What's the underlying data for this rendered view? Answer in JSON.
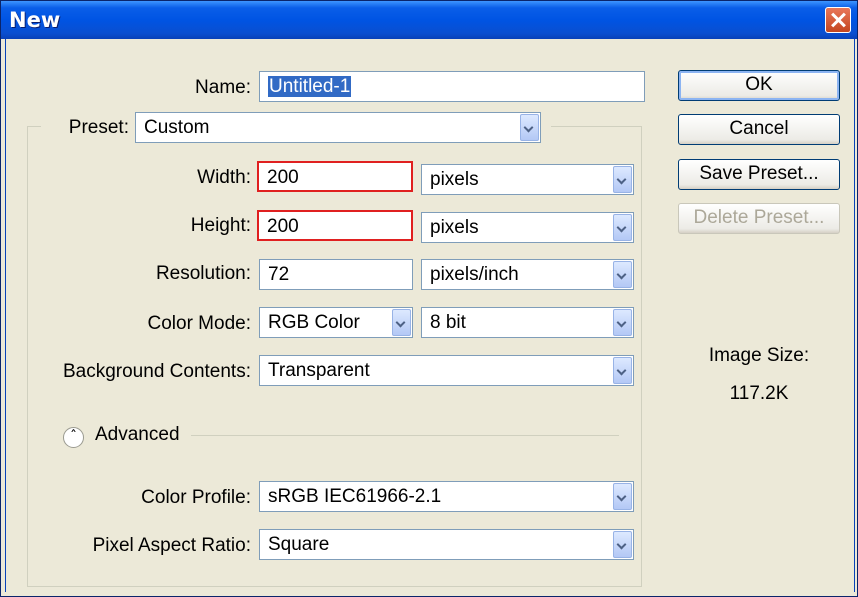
{
  "window": {
    "title": "New"
  },
  "name": {
    "label": "Name:",
    "value": "Untitled-1"
  },
  "preset": {
    "label": "Preset:",
    "value": "Custom"
  },
  "width": {
    "label": "Width:",
    "value": "200",
    "unit": "pixels"
  },
  "height": {
    "label": "Height:",
    "value": "200",
    "unit": "pixels"
  },
  "resolution": {
    "label": "Resolution:",
    "value": "72",
    "unit": "pixels/inch"
  },
  "color_mode": {
    "label": "Color Mode:",
    "value": "RGB Color",
    "depth": "8 bit"
  },
  "background": {
    "label": "Background Contents:",
    "value": "Transparent"
  },
  "advanced": {
    "label": "Advanced"
  },
  "color_profile": {
    "label": "Color Profile:",
    "value": "sRGB IEC61966-2.1"
  },
  "pixel_aspect": {
    "label": "Pixel Aspect Ratio:",
    "value": "Square"
  },
  "buttons": {
    "ok": "OK",
    "cancel": "Cancel",
    "save_preset": "Save Preset...",
    "delete_preset": "Delete Preset..."
  },
  "image_size": {
    "label": "Image Size:",
    "value": "117.2K"
  },
  "colors": {
    "titlebar": "#0054e3",
    "highlight": "#e02020",
    "dialog_bg": "#ece9d8"
  }
}
